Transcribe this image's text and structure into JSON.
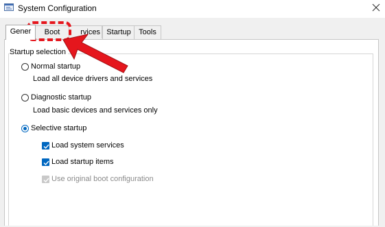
{
  "window": {
    "title": "System Configuration",
    "close_glyph": "✕"
  },
  "tabs": [
    {
      "label": "General",
      "active": true
    },
    {
      "label": "Boot",
      "highlighted": true
    },
    {
      "label": "Services"
    },
    {
      "label": "Startup"
    },
    {
      "label": "Tools"
    }
  ],
  "tab_visible_text": {
    "general": "Gener",
    "services": "rvices"
  },
  "startup_selection": {
    "group_label": "Startup selection",
    "options": [
      {
        "label": "Normal startup",
        "description": "Load all device drivers and services",
        "selected": false
      },
      {
        "label": "Diagnostic startup",
        "description": "Load basic devices and services only",
        "selected": false
      },
      {
        "label": "Selective startup",
        "selected": true
      }
    ],
    "selective_items": [
      {
        "label": "Load system services",
        "checked": true,
        "enabled": true
      },
      {
        "label": "Load startup items",
        "checked": true,
        "enabled": true
      },
      {
        "label": "Use original boot configuration",
        "checked": true,
        "enabled": false
      }
    ]
  },
  "colors": {
    "accent": "#0067c0",
    "annotation_red": "#e5161d"
  },
  "icons": {
    "app": "msconfig-icon",
    "close": "close-icon",
    "pointer": "red-arrow-annotation"
  }
}
